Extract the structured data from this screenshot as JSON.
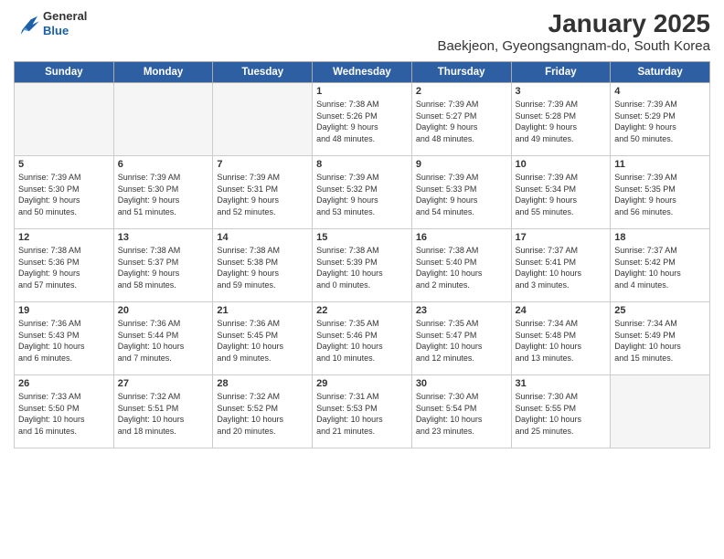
{
  "logo": {
    "line1": "General",
    "line2": "Blue"
  },
  "header": {
    "month": "January 2025",
    "location": "Baekjeon, Gyeongsangnam-do, South Korea"
  },
  "weekdays": [
    "Sunday",
    "Monday",
    "Tuesday",
    "Wednesday",
    "Thursday",
    "Friday",
    "Saturday"
  ],
  "weeks": [
    [
      {
        "day": "",
        "info": ""
      },
      {
        "day": "",
        "info": ""
      },
      {
        "day": "",
        "info": ""
      },
      {
        "day": "1",
        "info": "Sunrise: 7:38 AM\nSunset: 5:26 PM\nDaylight: 9 hours\nand 48 minutes."
      },
      {
        "day": "2",
        "info": "Sunrise: 7:39 AM\nSunset: 5:27 PM\nDaylight: 9 hours\nand 48 minutes."
      },
      {
        "day": "3",
        "info": "Sunrise: 7:39 AM\nSunset: 5:28 PM\nDaylight: 9 hours\nand 49 minutes."
      },
      {
        "day": "4",
        "info": "Sunrise: 7:39 AM\nSunset: 5:29 PM\nDaylight: 9 hours\nand 50 minutes."
      }
    ],
    [
      {
        "day": "5",
        "info": "Sunrise: 7:39 AM\nSunset: 5:30 PM\nDaylight: 9 hours\nand 50 minutes."
      },
      {
        "day": "6",
        "info": "Sunrise: 7:39 AM\nSunset: 5:30 PM\nDaylight: 9 hours\nand 51 minutes."
      },
      {
        "day": "7",
        "info": "Sunrise: 7:39 AM\nSunset: 5:31 PM\nDaylight: 9 hours\nand 52 minutes."
      },
      {
        "day": "8",
        "info": "Sunrise: 7:39 AM\nSunset: 5:32 PM\nDaylight: 9 hours\nand 53 minutes."
      },
      {
        "day": "9",
        "info": "Sunrise: 7:39 AM\nSunset: 5:33 PM\nDaylight: 9 hours\nand 54 minutes."
      },
      {
        "day": "10",
        "info": "Sunrise: 7:39 AM\nSunset: 5:34 PM\nDaylight: 9 hours\nand 55 minutes."
      },
      {
        "day": "11",
        "info": "Sunrise: 7:39 AM\nSunset: 5:35 PM\nDaylight: 9 hours\nand 56 minutes."
      }
    ],
    [
      {
        "day": "12",
        "info": "Sunrise: 7:38 AM\nSunset: 5:36 PM\nDaylight: 9 hours\nand 57 minutes."
      },
      {
        "day": "13",
        "info": "Sunrise: 7:38 AM\nSunset: 5:37 PM\nDaylight: 9 hours\nand 58 minutes."
      },
      {
        "day": "14",
        "info": "Sunrise: 7:38 AM\nSunset: 5:38 PM\nDaylight: 9 hours\nand 59 minutes."
      },
      {
        "day": "15",
        "info": "Sunrise: 7:38 AM\nSunset: 5:39 PM\nDaylight: 10 hours\nand 0 minutes."
      },
      {
        "day": "16",
        "info": "Sunrise: 7:38 AM\nSunset: 5:40 PM\nDaylight: 10 hours\nand 2 minutes."
      },
      {
        "day": "17",
        "info": "Sunrise: 7:37 AM\nSunset: 5:41 PM\nDaylight: 10 hours\nand 3 minutes."
      },
      {
        "day": "18",
        "info": "Sunrise: 7:37 AM\nSunset: 5:42 PM\nDaylight: 10 hours\nand 4 minutes."
      }
    ],
    [
      {
        "day": "19",
        "info": "Sunrise: 7:36 AM\nSunset: 5:43 PM\nDaylight: 10 hours\nand 6 minutes."
      },
      {
        "day": "20",
        "info": "Sunrise: 7:36 AM\nSunset: 5:44 PM\nDaylight: 10 hours\nand 7 minutes."
      },
      {
        "day": "21",
        "info": "Sunrise: 7:36 AM\nSunset: 5:45 PM\nDaylight: 10 hours\nand 9 minutes."
      },
      {
        "day": "22",
        "info": "Sunrise: 7:35 AM\nSunset: 5:46 PM\nDaylight: 10 hours\nand 10 minutes."
      },
      {
        "day": "23",
        "info": "Sunrise: 7:35 AM\nSunset: 5:47 PM\nDaylight: 10 hours\nand 12 minutes."
      },
      {
        "day": "24",
        "info": "Sunrise: 7:34 AM\nSunset: 5:48 PM\nDaylight: 10 hours\nand 13 minutes."
      },
      {
        "day": "25",
        "info": "Sunrise: 7:34 AM\nSunset: 5:49 PM\nDaylight: 10 hours\nand 15 minutes."
      }
    ],
    [
      {
        "day": "26",
        "info": "Sunrise: 7:33 AM\nSunset: 5:50 PM\nDaylight: 10 hours\nand 16 minutes."
      },
      {
        "day": "27",
        "info": "Sunrise: 7:32 AM\nSunset: 5:51 PM\nDaylight: 10 hours\nand 18 minutes."
      },
      {
        "day": "28",
        "info": "Sunrise: 7:32 AM\nSunset: 5:52 PM\nDaylight: 10 hours\nand 20 minutes."
      },
      {
        "day": "29",
        "info": "Sunrise: 7:31 AM\nSunset: 5:53 PM\nDaylight: 10 hours\nand 21 minutes."
      },
      {
        "day": "30",
        "info": "Sunrise: 7:30 AM\nSunset: 5:54 PM\nDaylight: 10 hours\nand 23 minutes."
      },
      {
        "day": "31",
        "info": "Sunrise: 7:30 AM\nSunset: 5:55 PM\nDaylight: 10 hours\nand 25 minutes."
      },
      {
        "day": "",
        "info": ""
      }
    ]
  ]
}
